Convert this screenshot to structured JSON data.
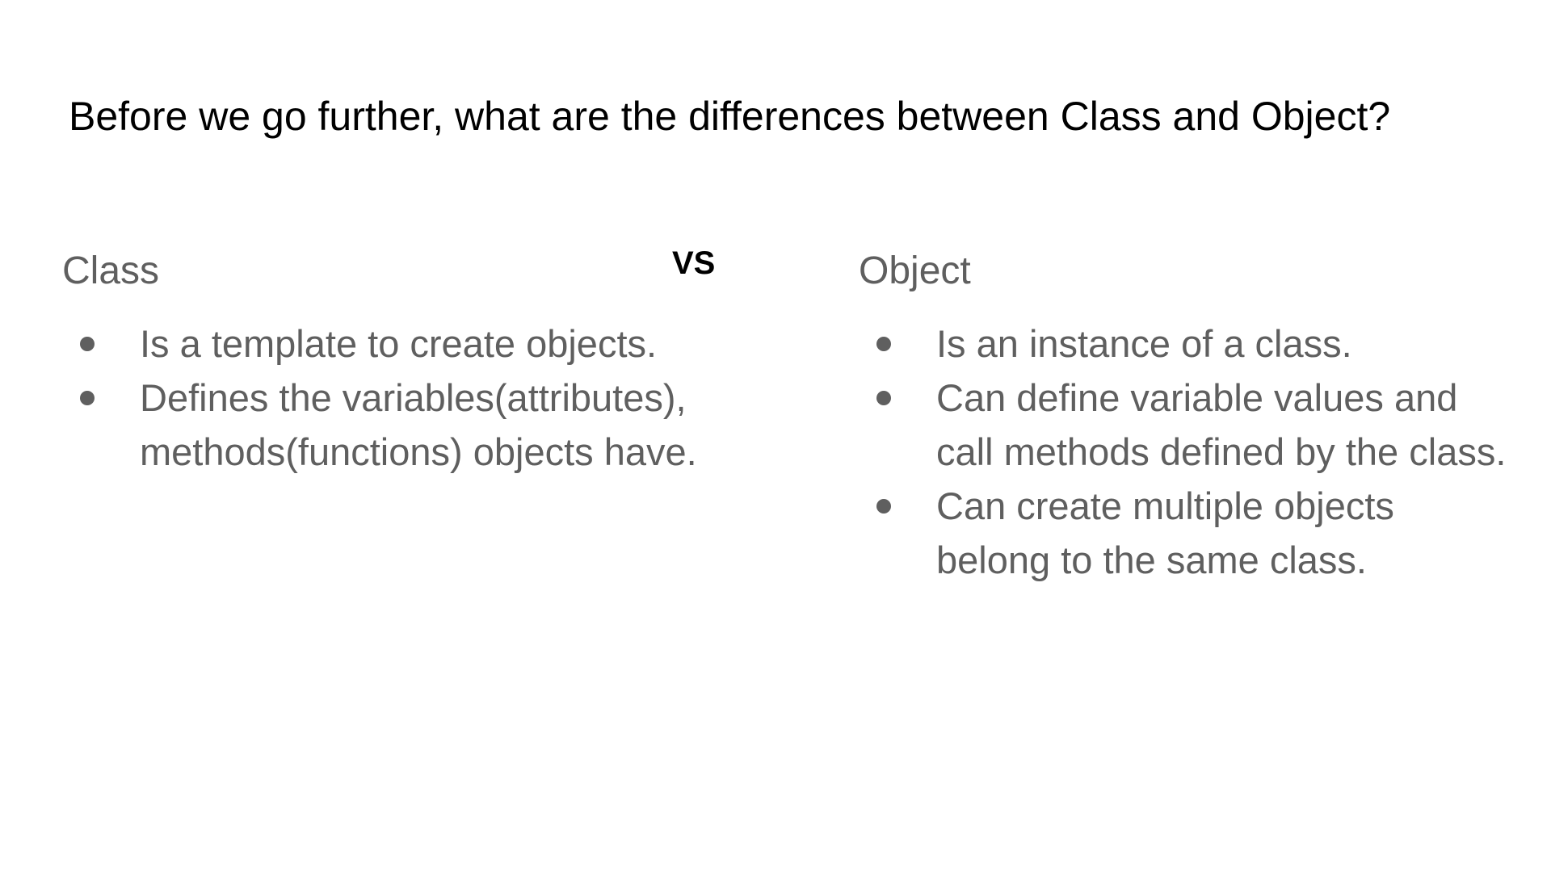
{
  "title": "Before we go further, what are the differences between Class and Object?",
  "vs_label": "VS",
  "left": {
    "heading": "Class",
    "bullets": [
      "Is a template to create objects.",
      "Defines the variables(attributes), methods(functions) objects have."
    ]
  },
  "right": {
    "heading": "Object",
    "bullets": [
      "Is an instance of a class.",
      "Can define variable values and call methods defined by the class.",
      "Can create multiple objects belong to the same class."
    ]
  },
  "colors": {
    "title_text": "#000000",
    "body_text": "#5f5f5f",
    "background": "#ffffff"
  }
}
